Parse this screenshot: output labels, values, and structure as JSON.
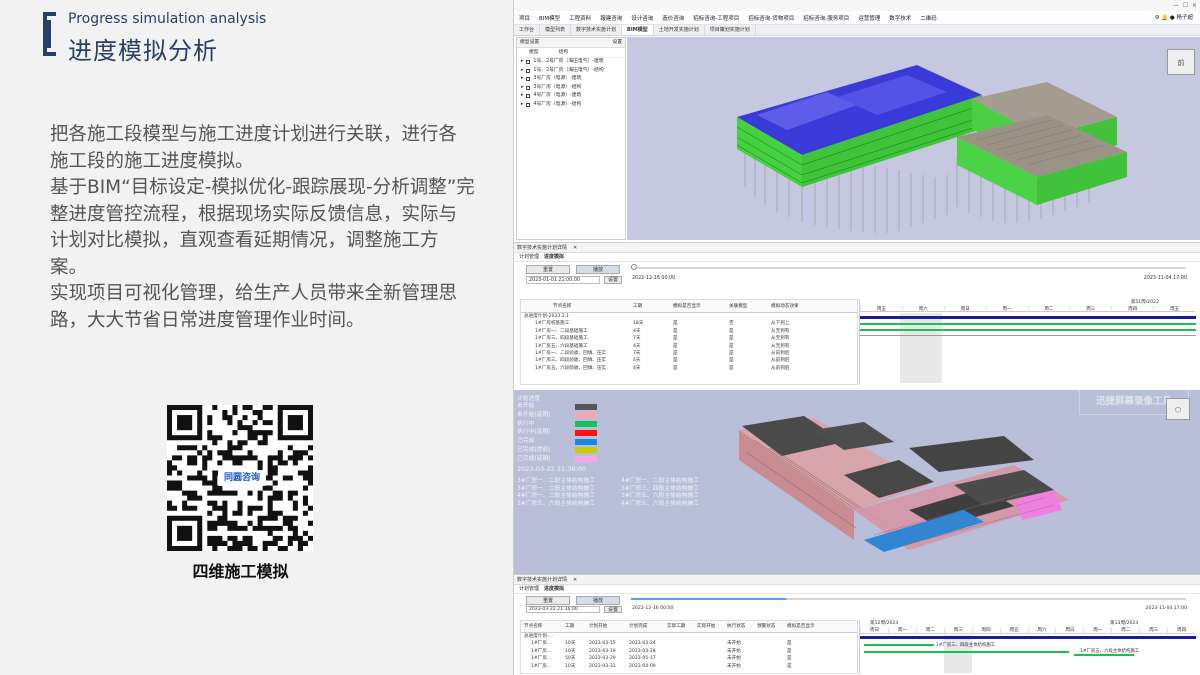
{
  "header": {
    "title_en": "Progress simulation analysis",
    "title_cn": "进度模拟分析"
  },
  "body": {
    "paragraphs": [
      "把各施工段模型与施工进度计划进行关联，进行各施工段的施工进度模拟。",
      "基于BIM“目标设定-模拟优化-跟踪展现-分析调整”完整进度管控流程，根据现场实际反馈信息，实际与计划对比模拟，直观查看延期情况，调整施工方案。",
      "实现项目可视化管理，给生产人员带来全新管理思路，大大节省日常进度管理作业时间。"
    ]
  },
  "qr": {
    "badge": "同圆咨询",
    "caption": "四维施工模拟"
  },
  "app": {
    "menu": [
      "项目",
      "BIM模型",
      "工程资料",
      "報建咨询",
      "设计咨询",
      "造价咨询",
      "招标咨询-工程项目",
      "招标咨询-货物项目",
      "招标咨询-服务项目",
      "运营管理",
      "数字技术",
      "二维码"
    ],
    "user": "杨子超",
    "tabs": [
      "工作台",
      "模型列表",
      "数字技术实施计划",
      "BIM模型",
      "土地开发实施计划",
      "项目策划实施计划"
    ],
    "active_tab": "BIM模型",
    "tree": {
      "header": "模型设置",
      "header_right": "设置",
      "col1": "模型",
      "col2": "结构",
      "items": [
        "1号、2号厂房（海压电气）-建筑",
        "1号、2号厂房（海压电气）-结构",
        "3号厂房（电源）-建筑",
        "3号厂房（电源）-结构",
        "4号厂房（电源）-建筑",
        "4号厂房（电源）-结构"
      ]
    },
    "navcube_top": "前"
  },
  "panel1": {
    "tab": "数字技术实施计划详情",
    "subtabs": [
      "计划管理",
      "进度模拟"
    ],
    "buttons": {
      "reset": "重置",
      "play": "播放",
      "set": "设置"
    },
    "start_datetime": "2023-01-01 21:00:00",
    "current_date": "2022-12-16 00:00",
    "end_date": "2023-11-04 17:00",
    "columns": [
      "节点名称",
      "工期",
      "模拟是否显示",
      "关联模型",
      "模拟动态效果"
    ],
    "rows": [
      [
        "总进度计划-2023.2.1",
        "",
        "",
        "",
        ""
      ],
      [
        "1#厂房桩基施工",
        "18天",
        "是",
        "否",
        "从下到上"
      ],
      [
        "1#厂房一、二段基础施工",
        "4天",
        "是",
        "是",
        "从无到有"
      ],
      [
        "1#厂房三、四段基础施工",
        "7天",
        "是",
        "是",
        "从无到有"
      ],
      [
        "1#厂房五、六段基础施工",
        "4天",
        "是",
        "是",
        "从无到有"
      ],
      [
        "1#厂房一、二段验收、回填、压实",
        "7天",
        "是",
        "是",
        "从前到后"
      ],
      [
        "1#厂房三、四段验收、回填、压实",
        "4天",
        "是",
        "是",
        "从前到后"
      ],
      [
        "1#厂房五、六段验收、回填、压实",
        "4天",
        "是",
        "是",
        "从前到后"
      ]
    ],
    "week_label": "第51周/2022",
    "days": [
      "周五",
      "周六",
      "周日",
      "周一",
      "周二",
      "周三",
      "周四",
      "周五"
    ]
  },
  "legend": {
    "title": "计划进度",
    "items": [
      {
        "label": "未开始",
        "color": "#555555"
      },
      {
        "label": "未开始(延期)",
        "color": "#f4a7b3"
      },
      {
        "label": "执行中",
        "color": "#18c15a"
      },
      {
        "label": "执行中(延期)",
        "color": "#ff1111"
      },
      {
        "label": "已完成",
        "color": "#1686e8"
      },
      {
        "label": "已完成(提前)",
        "color": "#cccc00"
      },
      {
        "label": "已完成(延期)",
        "color": "#f8a8e8"
      }
    ],
    "time": "2023-03-22 21:36:00",
    "activities": [
      "3#厂房一、二段主体结构施工",
      "4#厂房一、二段主体结构施工",
      "3#厂房一、二段主体结构施工",
      "3#厂房三、四段主体结构施工",
      "4#厂房一、二段主体结构施工",
      "3#厂房五、六段主体结构施工",
      "3#厂房五、六段主体结构施工",
      "4#厂房五、六段主体结构施工"
    ]
  },
  "watermark": "迅捷屏幕录像工具",
  "panel2": {
    "tab": "数字技术实施计划详情",
    "subtabs": [
      "计划管理",
      "进度模拟"
    ],
    "buttons": {
      "reset": "重置",
      "play": "播放",
      "set": "设置"
    },
    "start_datetime": "2023-03-22 21:36:00",
    "current_date": "2022-12-16 00:00",
    "end_date": "2023-11-04 17:00",
    "columns": [
      "节点名称",
      "工期",
      "计划开始",
      "计划完成",
      "实际工期",
      "实际开始",
      "执行状态",
      "预警状态",
      "模拟是否显示"
    ],
    "rows": [
      [
        "总进度计划-...",
        "",
        "",
        "",
        "",
        "",
        "",
        "",
        ""
      ],
      [
        "1#厂房...",
        "10天",
        "2023-03-15",
        "2023-03-24",
        "",
        "",
        "未开始",
        "",
        "是"
      ],
      [
        "1#厂房...",
        "10天",
        "2023-03-19",
        "2023-03-28",
        "",
        "",
        "未开始",
        "",
        "是"
      ],
      [
        "1#厂房...",
        "50天",
        "2023-03-29",
        "2023-05-17",
        "",
        "",
        "未开始",
        "",
        "是"
      ],
      [
        "1#厂房...",
        "10天",
        "2023-03-31",
        "2023-04-09",
        "",
        "",
        "未开始",
        "",
        "是"
      ]
    ],
    "week_a": "第12周/2023",
    "week_b": "第13周/2023",
    "days": [
      "周日",
      "周一",
      "周二",
      "周三",
      "周四",
      "周五",
      "周六",
      "周日",
      "周一",
      "周二",
      "周三",
      "周四"
    ],
    "bar_labels": [
      "1#厂房三、四段主体结构施工",
      "1#厂房五、六段主体结构施工"
    ]
  }
}
